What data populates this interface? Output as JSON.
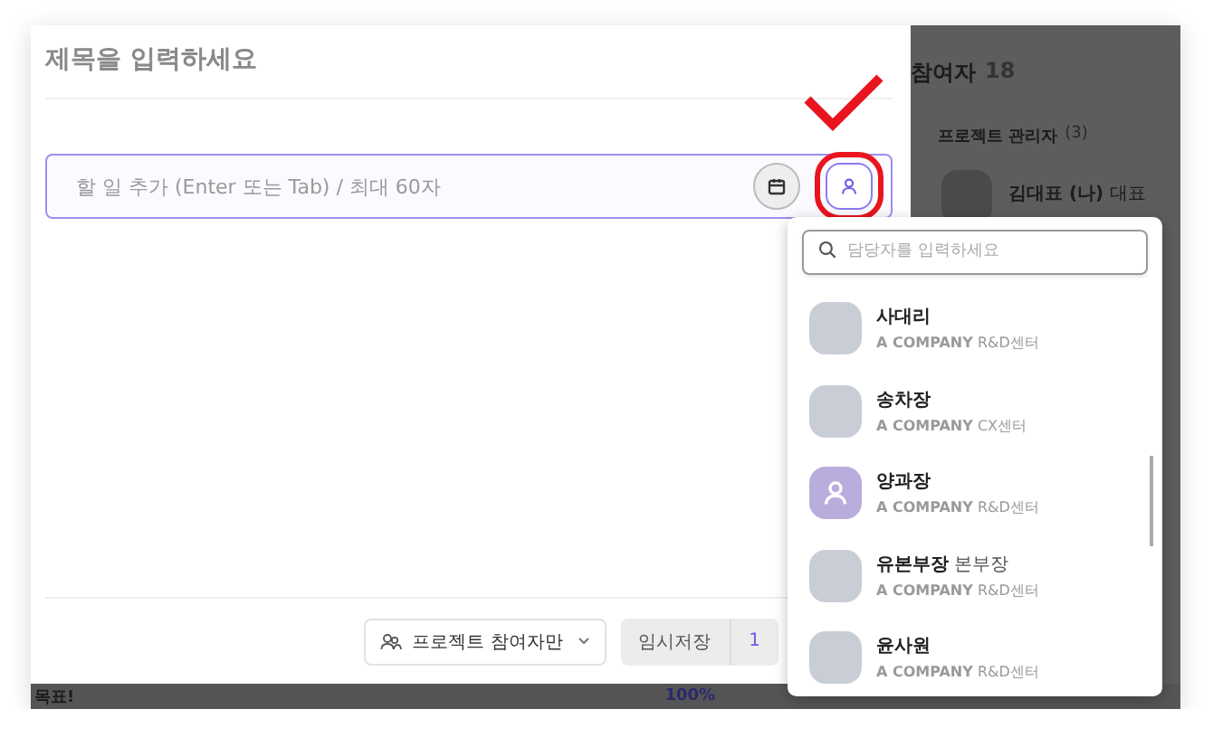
{
  "editor": {
    "title_placeholder": "제목을 입력하세요",
    "task_placeholder": "할 일 추가 (Enter 또는 Tab) / 최대 60자",
    "assignee_button_highlighted": true
  },
  "footer": {
    "visibility": "프로젝트 참여자만",
    "save_label": "임시저장",
    "save_count": "1"
  },
  "participants": {
    "title": "참여자",
    "count": "18",
    "group": "프로젝트 관리자",
    "group_count": "(3)",
    "person": {
      "name": "김대표 (나)",
      "role": "대표"
    }
  },
  "bottom_strip": {
    "goal_text": "목표!",
    "percent": "100%"
  },
  "assignee_dropdown": {
    "search_placeholder": "담당자를 입력하세요",
    "people": [
      {
        "name": "사대리",
        "org": "A COMPANY",
        "dept": "R&D센터",
        "kind": "photo"
      },
      {
        "name": "송차장",
        "org": "A COMPANY",
        "dept": "CX센터",
        "kind": "photo"
      },
      {
        "name": "양과장",
        "org": "A COMPANY",
        "dept": "R&D센터",
        "kind": "default"
      },
      {
        "name": "유본부장",
        "role": "본부장",
        "org": "A COMPANY",
        "dept": "R&D센터",
        "kind": "photo"
      },
      {
        "name": "윤사원",
        "org": "A COMPANY",
        "dept": "R&D센터",
        "kind": "photo"
      }
    ]
  }
}
